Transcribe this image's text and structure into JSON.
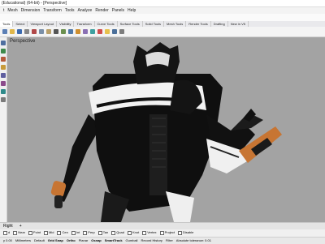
{
  "window": {
    "title": "(Educational) (64-bit) - [Perspective]"
  },
  "menu": [
    "t",
    "Mesh",
    "Dimension",
    "Transform",
    "Tools",
    "Analyze",
    "Render",
    "Panels",
    "Help"
  ],
  "tabs": [
    {
      "label": "Tools"
    },
    {
      "label": "Select"
    },
    {
      "label": "Viewport Layout"
    },
    {
      "label": "Visibility"
    },
    {
      "label": "Transform"
    },
    {
      "label": "Curve Tools"
    },
    {
      "label": "Surface Tools"
    },
    {
      "label": "Solid Tools"
    },
    {
      "label": "Mesh Tools"
    },
    {
      "label": "Render Tools"
    },
    {
      "label": "Drafting"
    },
    {
      "label": "New in V5"
    }
  ],
  "viewport": {
    "label": "Perspective"
  },
  "view_tabs": [
    "Right",
    "+"
  ],
  "osnap": [
    "d",
    "Near",
    "Point",
    "Mid",
    "Cen",
    "Int",
    "Perp",
    "Tan",
    "Quad",
    "Knot",
    "Vertex",
    "Project",
    "Disable"
  ],
  "status": {
    "coord": "y 0.00",
    "units": "Millimeters",
    "layer": "Default",
    "items": [
      "Grid Snap",
      "Ortho",
      "Planar",
      "Osnap",
      "SmartTrack",
      "Gumball",
      "Record History",
      "Filter",
      "Absolute tolerance: 0.01"
    ]
  },
  "colors": {
    "viewport_bg": "#a3a3a3",
    "armor": "#0e0e0e",
    "armor_white": "#f2f2f2",
    "accent_orange": "#c77533"
  }
}
